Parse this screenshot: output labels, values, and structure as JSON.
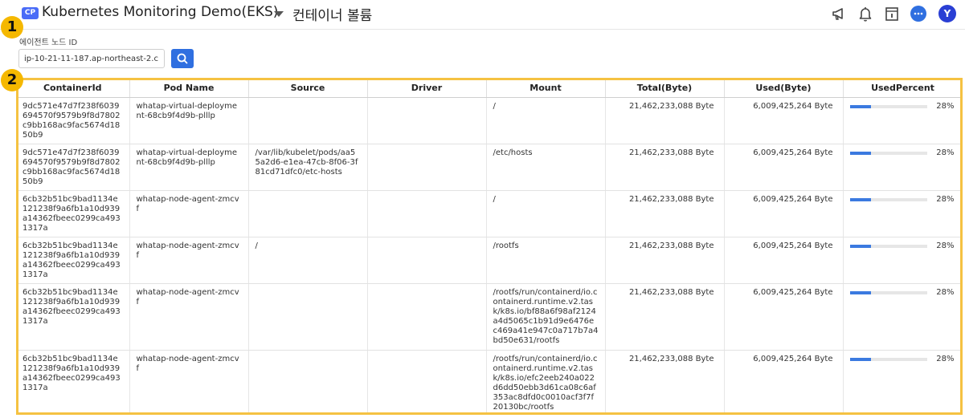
{
  "header": {
    "badge": "CP",
    "project": "Kubernetes Monitoring Demo(EKS)",
    "page_title": "컨테이너 볼륨",
    "icons": [
      "megaphone-icon",
      "bell-icon",
      "info-doc-icon",
      "chat-icon"
    ],
    "avatar": "Y"
  },
  "filter": {
    "label": "에이전트 노드 ID",
    "node_id_value": "ip-10-21-11-187.ap-northeast-2.c..."
  },
  "markers": [
    "1",
    "2"
  ],
  "table": {
    "columns": [
      "ContainerId",
      "Pod Name",
      "Source",
      "Driver",
      "Mount",
      "Total(Byte)",
      "Used(Byte)",
      "UsedPercent"
    ],
    "rows": [
      {
        "container_id": "9dc571e47d7f238f6039694570f9579b9f8d7802c9bb168ac9fac5674d1850b9",
        "pod": "whatap-virtual-deployment-68cb9f4d9b-plllp",
        "source": "",
        "driver": "",
        "mount": "/",
        "total": "21,462,233,088 Byte",
        "used": "6,009,425,264 Byte",
        "percent": "28%",
        "percent_value": 28
      },
      {
        "container_id": "9dc571e47d7f238f6039694570f9579b9f8d7802c9bb168ac9fac5674d1850b9",
        "pod": "whatap-virtual-deployment-68cb9f4d9b-plllp",
        "source": "/var/lib/kubelet/pods/aa55a2d6-e1ea-47cb-8f06-3f81cd71dfc0/etc-hosts",
        "driver": "",
        "mount": "/etc/hosts",
        "total": "21,462,233,088 Byte",
        "used": "6,009,425,264 Byte",
        "percent": "28%",
        "percent_value": 28
      },
      {
        "container_id": "6cb32b51bc9bad1134e121238f9a6fb1a10d939a14362fbeec0299ca4931317a",
        "pod": "whatap-node-agent-zmcvf",
        "source": "",
        "driver": "",
        "mount": "/",
        "total": "21,462,233,088 Byte",
        "used": "6,009,425,264 Byte",
        "percent": "28%",
        "percent_value": 28
      },
      {
        "container_id": "6cb32b51bc9bad1134e121238f9a6fb1a10d939a14362fbeec0299ca4931317a",
        "pod": "whatap-node-agent-zmcvf",
        "source": "/",
        "driver": "",
        "mount": "/rootfs",
        "total": "21,462,233,088 Byte",
        "used": "6,009,425,264 Byte",
        "percent": "28%",
        "percent_value": 28
      },
      {
        "container_id": "6cb32b51bc9bad1134e121238f9a6fb1a10d939a14362fbeec0299ca4931317a",
        "pod": "whatap-node-agent-zmcvf",
        "source": "",
        "driver": "",
        "mount": "/rootfs/run/containerd/io.containerd.runtime.v2.task/k8s.io/bf88a6f98af2124a4d5065c1b91d9e6476ec469a41e947c0a717b7a4bd50e631/rootfs",
        "total": "21,462,233,088 Byte",
        "used": "6,009,425,264 Byte",
        "percent": "28%",
        "percent_value": 28
      },
      {
        "container_id": "6cb32b51bc9bad1134e121238f9a6fb1a10d939a14362fbeec0299ca4931317a",
        "pod": "whatap-node-agent-zmcvf",
        "source": "",
        "driver": "",
        "mount": "/rootfs/run/containerd/io.containerd.runtime.v2.task/k8s.io/efc2eeb240a022d6dd50ebb3d61ca08c6af353ac8dfd0c0010acf3f7f20130bc/rootfs",
        "total": "21,462,233,088 Byte",
        "used": "6,009,425,264 Byte",
        "percent": "28%",
        "percent_value": 28
      }
    ]
  },
  "colors": {
    "accent": "#2f6fe0",
    "badge": "#4a6cf7",
    "marker": "#f5b800",
    "highlight": "#f5c242",
    "bar_fill": "#3b7ae0"
  }
}
